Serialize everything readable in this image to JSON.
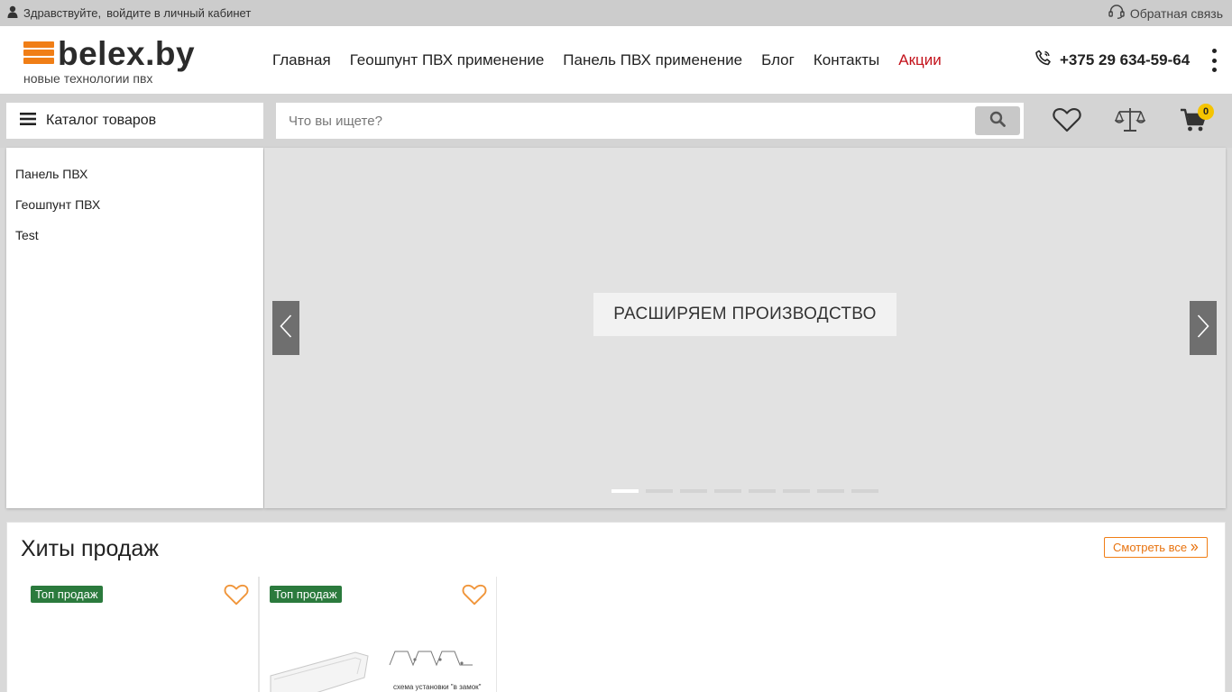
{
  "topbar": {
    "greeting": "Здравствуйте,",
    "login_link": "войдите в личный кабинет",
    "feedback": "Обратная связь"
  },
  "logo": {
    "name": "belex.by",
    "tagline": "новые технологии пвх"
  },
  "nav": {
    "items": [
      {
        "label": "Главная"
      },
      {
        "label": "Геошпунт ПВХ применение"
      },
      {
        "label": "Панель ПВХ применение"
      },
      {
        "label": "Блог"
      },
      {
        "label": "Контакты"
      },
      {
        "label": "Акции"
      }
    ]
  },
  "phone": "+375 29 634-59-64",
  "catalog": {
    "button_label": "Каталог товаров",
    "items": [
      {
        "label": "Панель ПВХ"
      },
      {
        "label": "Геошпунт ПВХ"
      },
      {
        "label": "Test"
      }
    ]
  },
  "search": {
    "value": "",
    "placeholder": "Что вы ищете?"
  },
  "cart": {
    "count": "0"
  },
  "slider": {
    "caption": "РАСШИРЯЕМ ПРОИЗВОДСТВО",
    "slide_count": 8,
    "active_index": 0
  },
  "hits": {
    "title": "Хиты продаж",
    "see_all": "Смотреть все",
    "products": [
      {
        "badge": "Топ продаж"
      },
      {
        "badge": "Топ продаж",
        "image_caption": "схема установки \"в замок\""
      }
    ]
  },
  "colors": {
    "accent_orange": "#f07e16",
    "promo_red": "#c3121b",
    "badge_green": "#2b7a3d",
    "cart_badge_yellow": "#f5c400"
  },
  "icons": {
    "user": "user-icon",
    "headset": "headset-icon",
    "phone": "phone-icon",
    "menu": "hamburger-icon",
    "search": "search-icon",
    "favorites": "heart-icon",
    "compare": "scales-icon",
    "cart": "cart-icon"
  }
}
